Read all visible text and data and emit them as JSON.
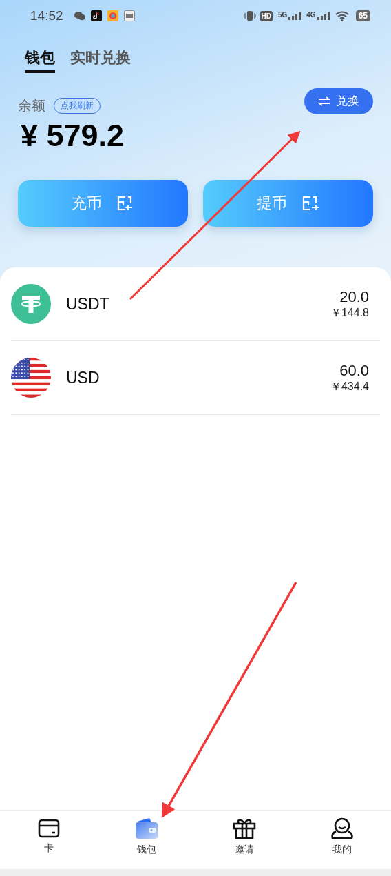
{
  "status_bar": {
    "time": "14:52",
    "hd": "HD",
    "networks": [
      "5G",
      "4G"
    ],
    "battery": "65"
  },
  "tabs": [
    {
      "label": "钱包",
      "selected": true
    },
    {
      "label": "实时兑换",
      "selected": false
    }
  ],
  "balance": {
    "label": "余额",
    "refresh": "点我刷新",
    "amount": "¥ 579.2",
    "exchange_button": "兑换"
  },
  "actions": [
    {
      "label": "充币"
    },
    {
      "label": "提币"
    }
  ],
  "assets": [
    {
      "name": "USDT",
      "amount": "20.0",
      "cny": "￥144.8"
    },
    {
      "name": "USD",
      "amount": "60.0",
      "cny": "￥434.4"
    }
  ],
  "nav": [
    {
      "label": "卡",
      "selected": false
    },
    {
      "label": "钱包",
      "selected": true
    },
    {
      "label": "邀请",
      "selected": false
    },
    {
      "label": "我的",
      "selected": false
    }
  ]
}
